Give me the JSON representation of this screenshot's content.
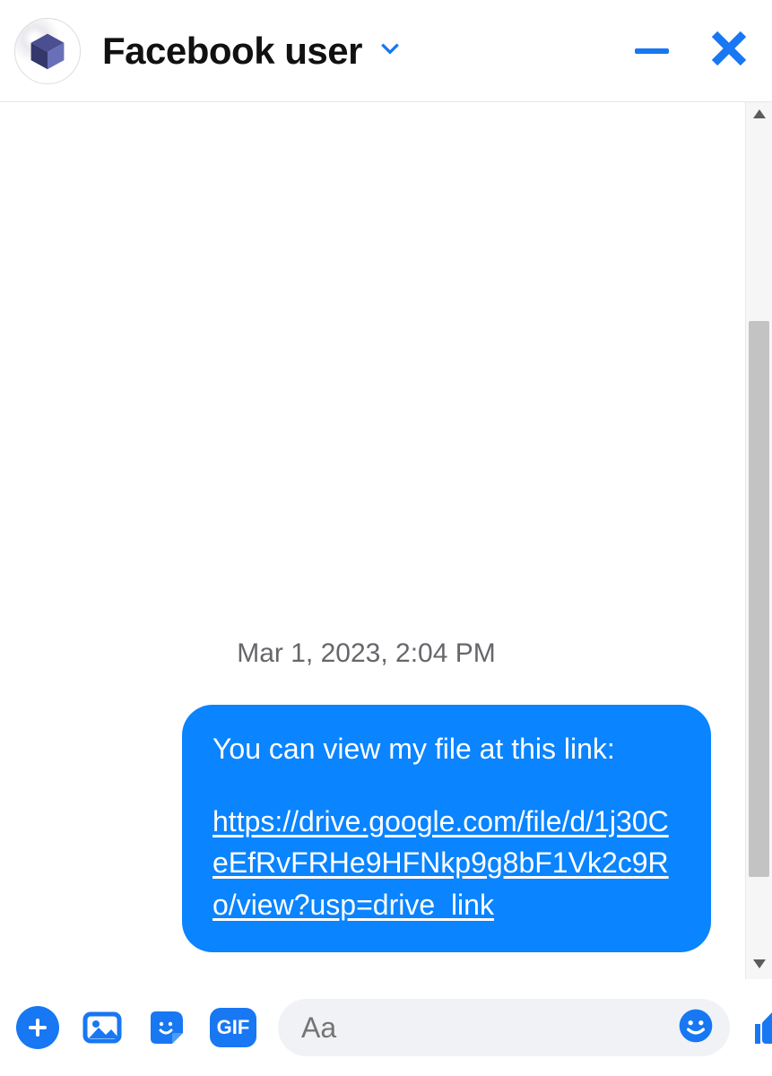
{
  "header": {
    "title": "Facebook user"
  },
  "chat": {
    "timestamp": "Mar 1, 2023, 2:04 PM",
    "message_intro": "You can view my file at this link:",
    "message_link": "https://drive.google.com/file/d/1j30CeEfRvFRHe9HFNkp9g8bF1Vk2c9Ro/view?usp=drive_link"
  },
  "composer": {
    "placeholder": "Aa",
    "gif_label": "GIF"
  },
  "colors": {
    "accent": "#1877f2",
    "bubble": "#0a84ff"
  }
}
